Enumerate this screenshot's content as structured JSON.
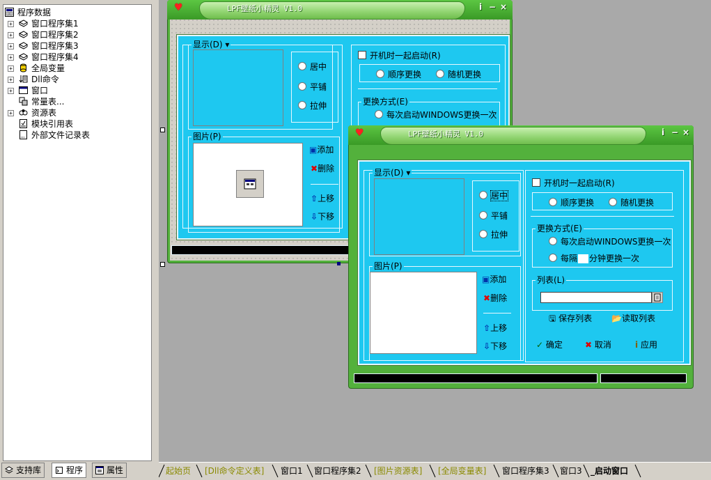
{
  "tree": {
    "root": "程序数据",
    "items": [
      {
        "label": "窗口程序集1",
        "icon": "module-icon",
        "expand": "+"
      },
      {
        "label": "窗口程序集2",
        "icon": "module-icon",
        "expand": "+"
      },
      {
        "label": "窗口程序集3",
        "icon": "module-icon",
        "expand": "+"
      },
      {
        "label": "窗口程序集4",
        "icon": "module-icon",
        "expand": "+"
      },
      {
        "label": "全局变量",
        "icon": "variable-icon",
        "expand": "+"
      },
      {
        "label": "Dll命令",
        "icon": "dll-icon",
        "expand": "+"
      },
      {
        "label": "窗口",
        "icon": "window-icon",
        "expand": "+"
      },
      {
        "label": "常量表...",
        "icon": "constant-icon",
        "expand": ""
      },
      {
        "label": "资源表",
        "icon": "resource-icon",
        "expand": "+"
      },
      {
        "label": "模块引用表",
        "icon": "module-ref-icon",
        "expand": ""
      },
      {
        "label": "外部文件记录表",
        "icon": "external-file-icon",
        "expand": ""
      }
    ]
  },
  "left_tabs": [
    {
      "label": "支持库",
      "active": false
    },
    {
      "label": "程序",
      "active": true
    },
    {
      "label": "属性",
      "active": false
    }
  ],
  "skin_title": "LPF壁纸小精灵 V1.0",
  "form1": {
    "display_group": "显示(D)",
    "radios": [
      "居中",
      "平铺",
      "拉伸"
    ],
    "picture_group": "图片(P)",
    "add": "添加",
    "delete": "删除",
    "move_up": "上移",
    "move_down": "下移",
    "startup_checkbox": "开机时一起启动(R)",
    "order_radio": "顺序更换",
    "random_radio": "随机更换",
    "change_group": "更换方式(E)",
    "each_windows": "每次启动WINDOWS更换一次"
  },
  "form2": {
    "display_group": "显示(D)",
    "radios": [
      "居中",
      "平铺",
      "拉伸"
    ],
    "picture_group": "图片(P)",
    "add": "添加",
    "delete": "删除",
    "move_up": "上移",
    "move_down": "下移",
    "startup_checkbox": "开机时一起启动(R)",
    "order_radio": "顺序更换",
    "random_radio": "随机更换",
    "change_group": "更换方式(E)",
    "each_windows": "每次启动WINDOWS更换一次",
    "every_prefix": "每隔",
    "every_suffix": "分钟更换一次",
    "list_group": "列表(L)",
    "save_list": "保存列表",
    "read_list": "读取列表",
    "ok": "确定",
    "cancel": "取消",
    "apply": "应用"
  },
  "bottom_tabs": [
    {
      "label": "起始页",
      "style": "olive"
    },
    {
      "label": "[Dll命令定义表]",
      "style": "olive"
    },
    {
      "label": "窗口1",
      "style": "normal"
    },
    {
      "label": "窗口程序集2",
      "style": "normal"
    },
    {
      "label": "[图片资源表]",
      "style": "olive"
    },
    {
      "label": "[全局变量表]",
      "style": "olive"
    },
    {
      "label": "窗口程序集3",
      "style": "normal"
    },
    {
      "label": "窗口3",
      "style": "normal"
    },
    {
      "label": "_启动窗口",
      "style": "active"
    }
  ],
  "colors": {
    "skin_green": "#53b13c",
    "panel_cyan": "#1ec8f0",
    "designer_bg": "#a9a9a9",
    "tab_olive": "#8a8a00"
  }
}
